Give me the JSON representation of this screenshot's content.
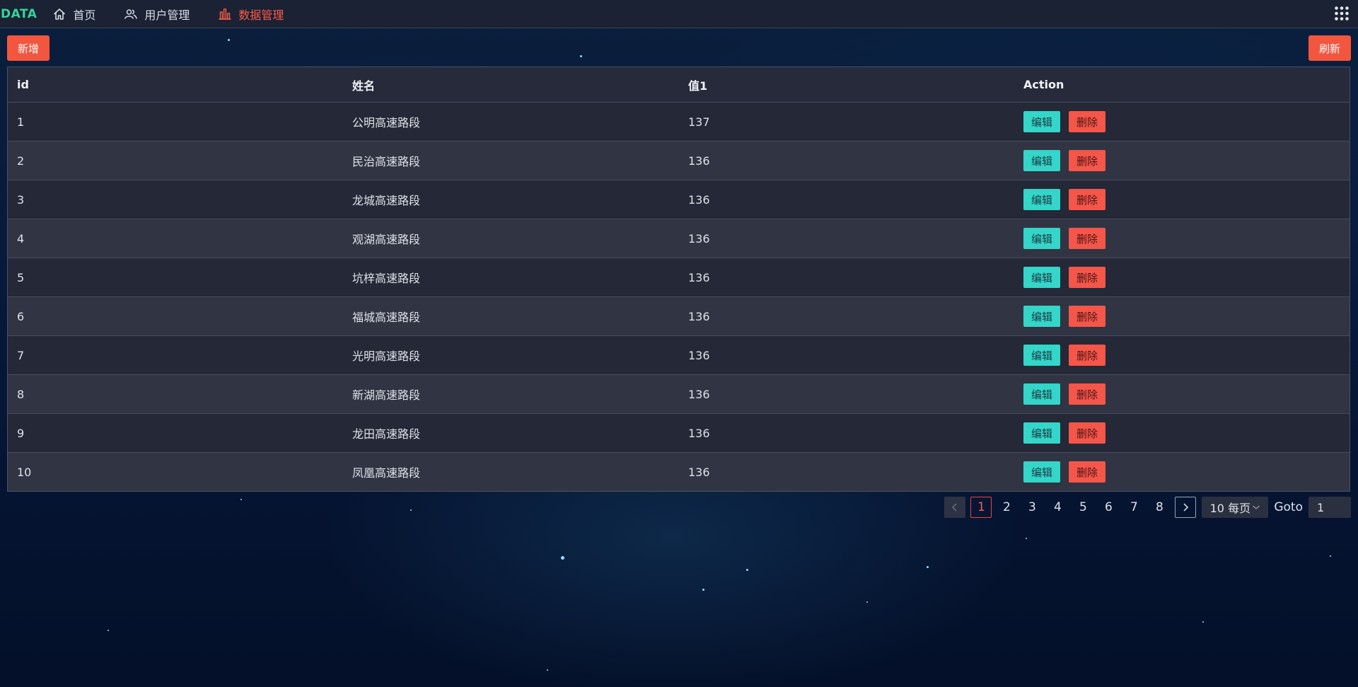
{
  "nav": {
    "brand": "DATA",
    "items": [
      {
        "label": "首页",
        "icon": "home-icon"
      },
      {
        "label": "用户管理",
        "icon": "users-icon"
      },
      {
        "label": "数据管理",
        "icon": "bar-chart-icon",
        "active": true
      }
    ],
    "active_color": "#ff5a4b",
    "brand_color": "#35d49b"
  },
  "toolbar": {
    "add_label": "新增",
    "refresh_label": "刷新",
    "button_color": "#f2563f"
  },
  "table": {
    "columns": [
      "id",
      "姓名",
      "值1",
      "Action"
    ],
    "edit_label": "编辑",
    "delete_label": "删除",
    "rows": [
      {
        "id": "1",
        "name": "公明高速路段",
        "value": "137"
      },
      {
        "id": "2",
        "name": "民治高速路段",
        "value": "136"
      },
      {
        "id": "3",
        "name": "龙城高速路段",
        "value": "136"
      },
      {
        "id": "4",
        "name": "观湖高速路段",
        "value": "136"
      },
      {
        "id": "5",
        "name": "坑梓高速路段",
        "value": "136"
      },
      {
        "id": "6",
        "name": "福城高速路段",
        "value": "136"
      },
      {
        "id": "7",
        "name": "光明高速路段",
        "value": "136"
      },
      {
        "id": "8",
        "name": "新湖高速路段",
        "value": "136"
      },
      {
        "id": "9",
        "name": "龙田高速路段",
        "value": "136"
      },
      {
        "id": "10",
        "name": "凤凰高速路段",
        "value": "136"
      }
    ]
  },
  "pagination": {
    "pages": [
      "1",
      "2",
      "3",
      "4",
      "5",
      "6",
      "7",
      "8"
    ],
    "current": "1",
    "page_size_label": "10 每页",
    "goto_label": "Goto",
    "goto_value": "1"
  }
}
